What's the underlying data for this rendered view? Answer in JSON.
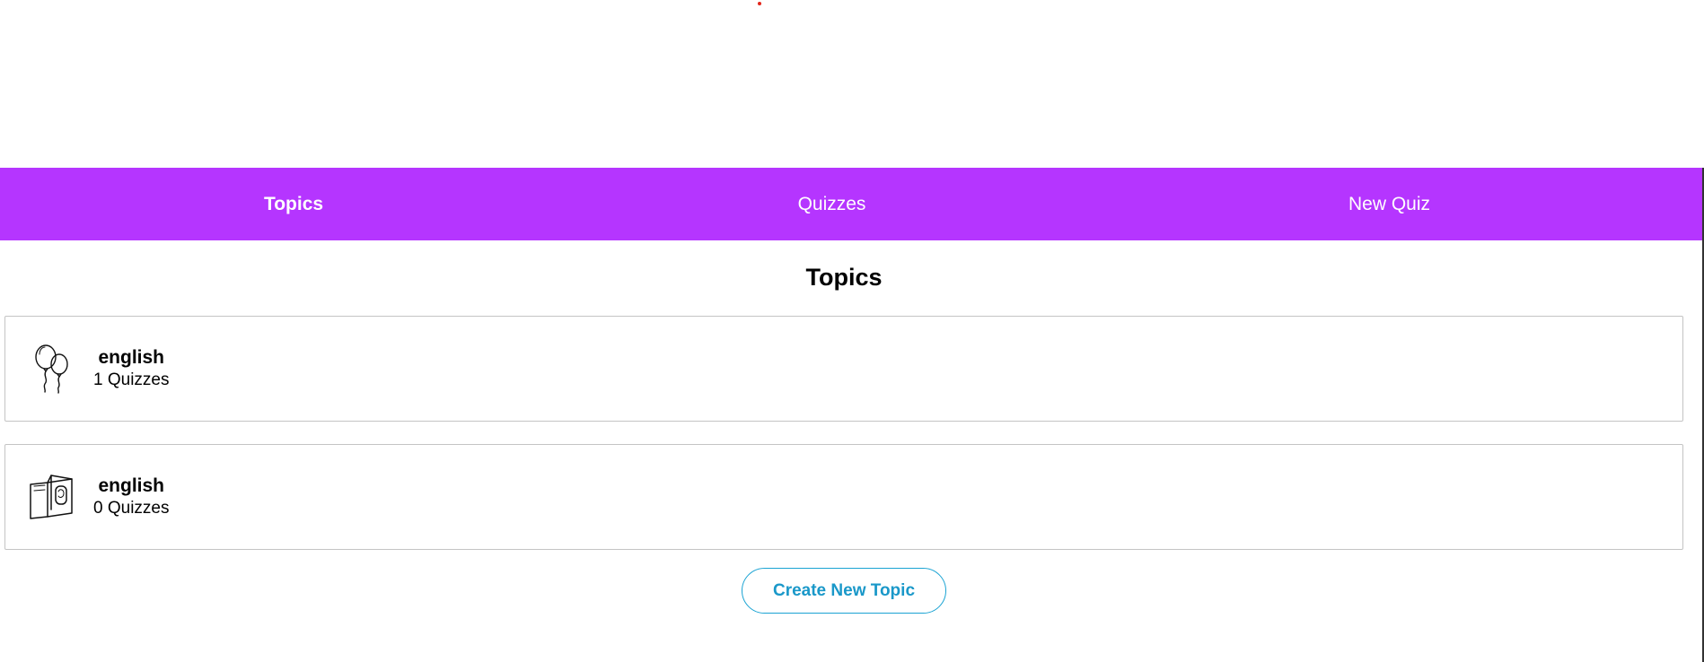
{
  "nav": {
    "items": [
      {
        "label": "Topics",
        "active": true
      },
      {
        "label": "Quizzes",
        "active": false
      },
      {
        "label": "New Quiz",
        "active": false
      }
    ],
    "background_color": "#b535ff"
  },
  "main": {
    "title": "Topics",
    "topics": [
      {
        "name": "english",
        "count_label": "1 Quizzes",
        "icon": "balloons-icon"
      },
      {
        "name": "english",
        "count_label": "0 Quizzes",
        "icon": "book-icon"
      }
    ],
    "create_button_label": "Create New Topic",
    "accent_color": "#1aa3d3"
  }
}
